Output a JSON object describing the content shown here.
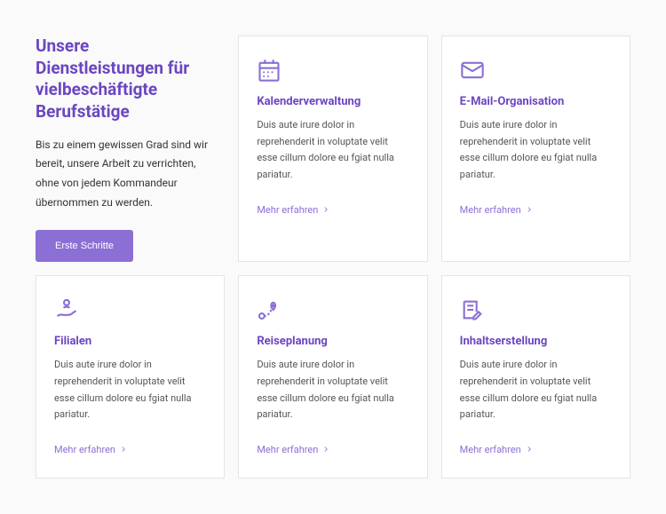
{
  "intro": {
    "title": "Unsere Dienstleistungen für vielbeschäftigte Berufstätige",
    "description": "Bis zu einem gewissen Grad sind wir bereit, unsere Arbeit zu verrichten, ohne von jedem Kommandeur übernommen zu werden.",
    "button": "Erste Schritte"
  },
  "cards": [
    {
      "title": "Kalenderverwaltung",
      "description": "Duis aute irure dolor in reprehenderit in voluptate velit esse cillum dolore eu fgiat nulla pariatur.",
      "link": "Mehr erfahren"
    },
    {
      "title": "E-Mail-Organisation",
      "description": "Duis aute irure dolor in reprehenderit in voluptate velit esse cillum dolore eu fgiat nulla pariatur.",
      "link": "Mehr erfahren"
    },
    {
      "title": "Filialen",
      "description": "Duis aute irure dolor in reprehenderit in voluptate velit esse cillum dolore eu fgiat nulla pariatur.",
      "link": "Mehr erfahren"
    },
    {
      "title": "Reiseplanung",
      "description": "Duis aute irure dolor in reprehenderit in voluptate velit esse cillum dolore eu fgiat nulla pariatur.",
      "link": "Mehr erfahren"
    },
    {
      "title": "Inhaltserstellung",
      "description": "Duis aute irure dolor in reprehenderit in voluptate velit esse cillum dolore eu fgiat nulla pariatur.",
      "link": "Mehr erfahren"
    }
  ]
}
